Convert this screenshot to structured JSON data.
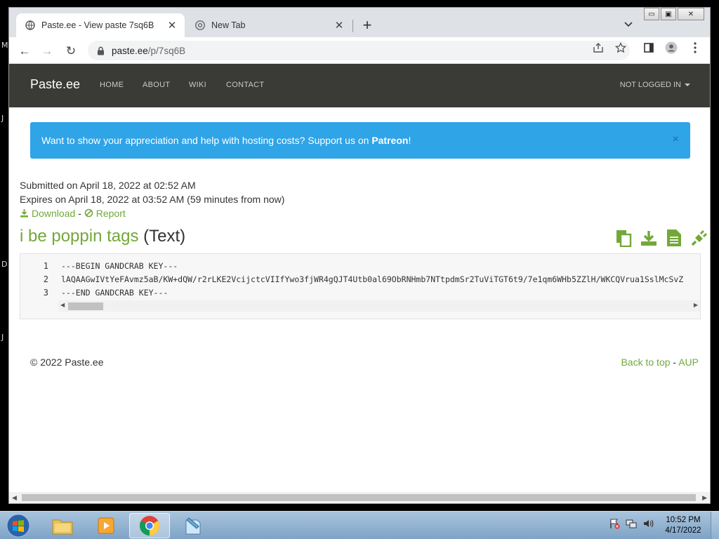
{
  "desktop": {
    "left_letters": [
      "M",
      "J",
      "D",
      "J"
    ]
  },
  "browser": {
    "tabs": [
      {
        "title": "Paste.ee - View paste 7sq6B",
        "close": "✕"
      },
      {
        "title": "New Tab",
        "close": "✕"
      }
    ],
    "new_tab": "+",
    "tab_search": "⌄",
    "window_controls": {
      "minimize": "▭",
      "maximize": "▣",
      "close": "✕"
    },
    "nav": {
      "back": "←",
      "forward": "→",
      "reload": "↻"
    },
    "url": {
      "host": "paste.ee",
      "path": "/p/7sq6B"
    }
  },
  "site": {
    "brand": "Paste.ee",
    "nav_links": [
      "HOME",
      "ABOUT",
      "WIKI",
      "CONTACT"
    ],
    "account": "NOT LOGGED IN",
    "alert": {
      "text": "Want to show your appreciation and help with hosting costs? Support us on ",
      "link": "Patreon",
      "suffix": "!",
      "close": "×"
    },
    "meta": {
      "submitted": "Submitted on April 18, 2022 at 02:52 AM",
      "expires": "Expires on April 18, 2022 at 03:52 AM (59 minutes from now)",
      "download": "Download",
      "separator": "-",
      "report": "Report"
    },
    "paste": {
      "name": "i be poppin tags",
      "type": "(Text)",
      "lines": [
        {
          "n": "1",
          "text": "---BEGIN GANDCRAB KEY---"
        },
        {
          "n": "2",
          "text": "lAQAAGwIVtYeFAvmz5aB/KW+dQW/r2rLKE2VcijctcVIIfYwo3fjWR4gQJT4Utb0al69ObRNHmb7NTtpdmSr2TuViTGT6t9/7e1qm6WHb5ZZlH/WKCQVrua1SslMcSvZ"
        },
        {
          "n": "3",
          "text": "---END GANDCRAB KEY---"
        }
      ]
    },
    "footer": {
      "copyright": "© 2022 Paste.ee",
      "back_to_top": "Back to top",
      "separator": "-",
      "aup": "AUP"
    }
  },
  "taskbar": {
    "clock_time": "10:52 PM",
    "clock_date": "4/17/2022"
  },
  "colors": {
    "navbar": "#3a3a36",
    "alert": "#2fa4e7",
    "link_green": "#73a839"
  }
}
